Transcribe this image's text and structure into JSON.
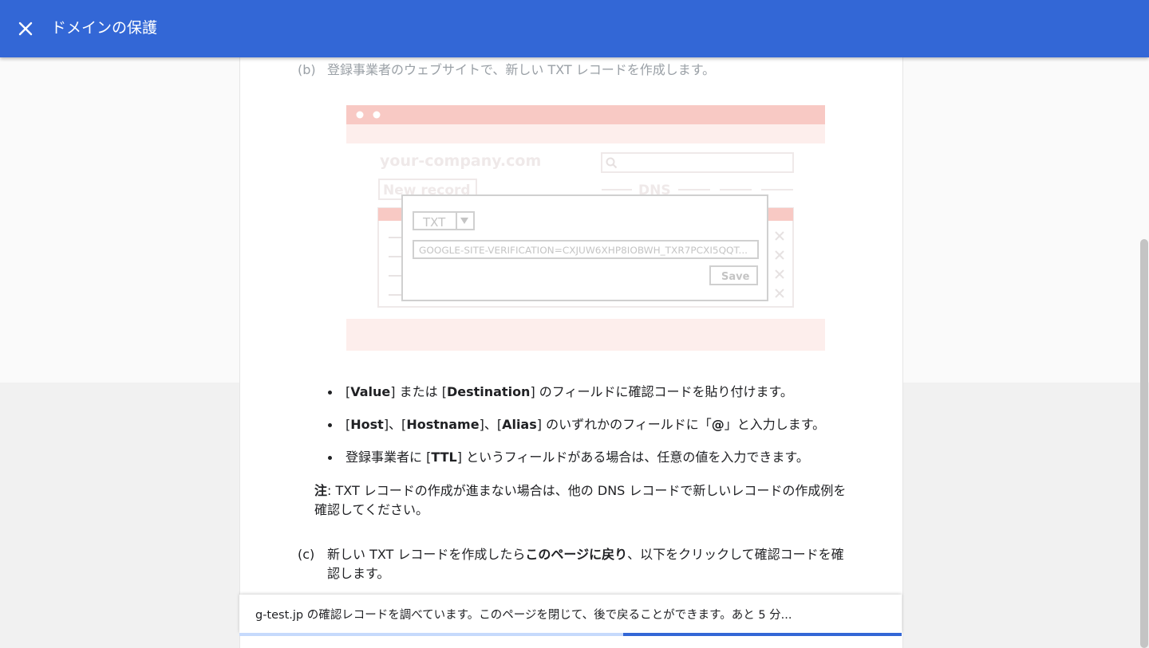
{
  "header": {
    "title": "ドメインの保護",
    "close_icon": "close-icon"
  },
  "steps": {
    "b": {
      "letter": "(b)",
      "text": "登録事業者のウェブサイトで、新しい TXT レコードを作成します。"
    },
    "c": {
      "letter": "(c)",
      "text_before": "新しい TXT レコードを作成したら",
      "text_bold": "このページに戻り",
      "text_after": "、以下をクリックして確認コードを確認します。"
    }
  },
  "illustration": {
    "site_name": "your-company.com",
    "new_record_label": "New record",
    "dns_label": "DNS",
    "record_type": "TXT",
    "txt_value": "GOOGLE-SITE-VERIFICATION=CXJUW6XHP8IOBWH_TXR7PCXI5QQT...",
    "save_label": "Save",
    "search_icon": "search-icon",
    "dropdown_icon": "triangle-down-icon",
    "delete_icon": "x-icon"
  },
  "bullets": [
    {
      "p1": "[",
      "b1": "Value",
      "p2": "] または [",
      "b2": "Destination",
      "p3": "] のフィールドに確認コードを貼り付けます。"
    },
    {
      "p1": "[",
      "b1": "Host",
      "p2": "]、[",
      "b2": "Hostname",
      "p3": "]、[",
      "b3": "Alias",
      "p4": "] のいずれかのフィールドに「",
      "b4": "@",
      "p5": "」と入力します。"
    },
    {
      "p1": "登録事業者に [",
      "b1": "TTL",
      "p2": "] というフィールドがある場合は、任意の値を入力できます。"
    }
  ],
  "note": {
    "label": "注",
    "text": ": TXT レコードの作成が進まない場合は、他の DNS レコードで新しいレコードの作成例を確認してください。"
  },
  "status": {
    "message": "g-test.jp の確認レコードを調べています。このページを閉じて、後で戻ることができます。あと 5 分...",
    "progress": 0.58
  },
  "colors": {
    "header": "#3367d6",
    "progress_fill": "#3367d6",
    "illustration_accent": "#f8c9c4"
  }
}
